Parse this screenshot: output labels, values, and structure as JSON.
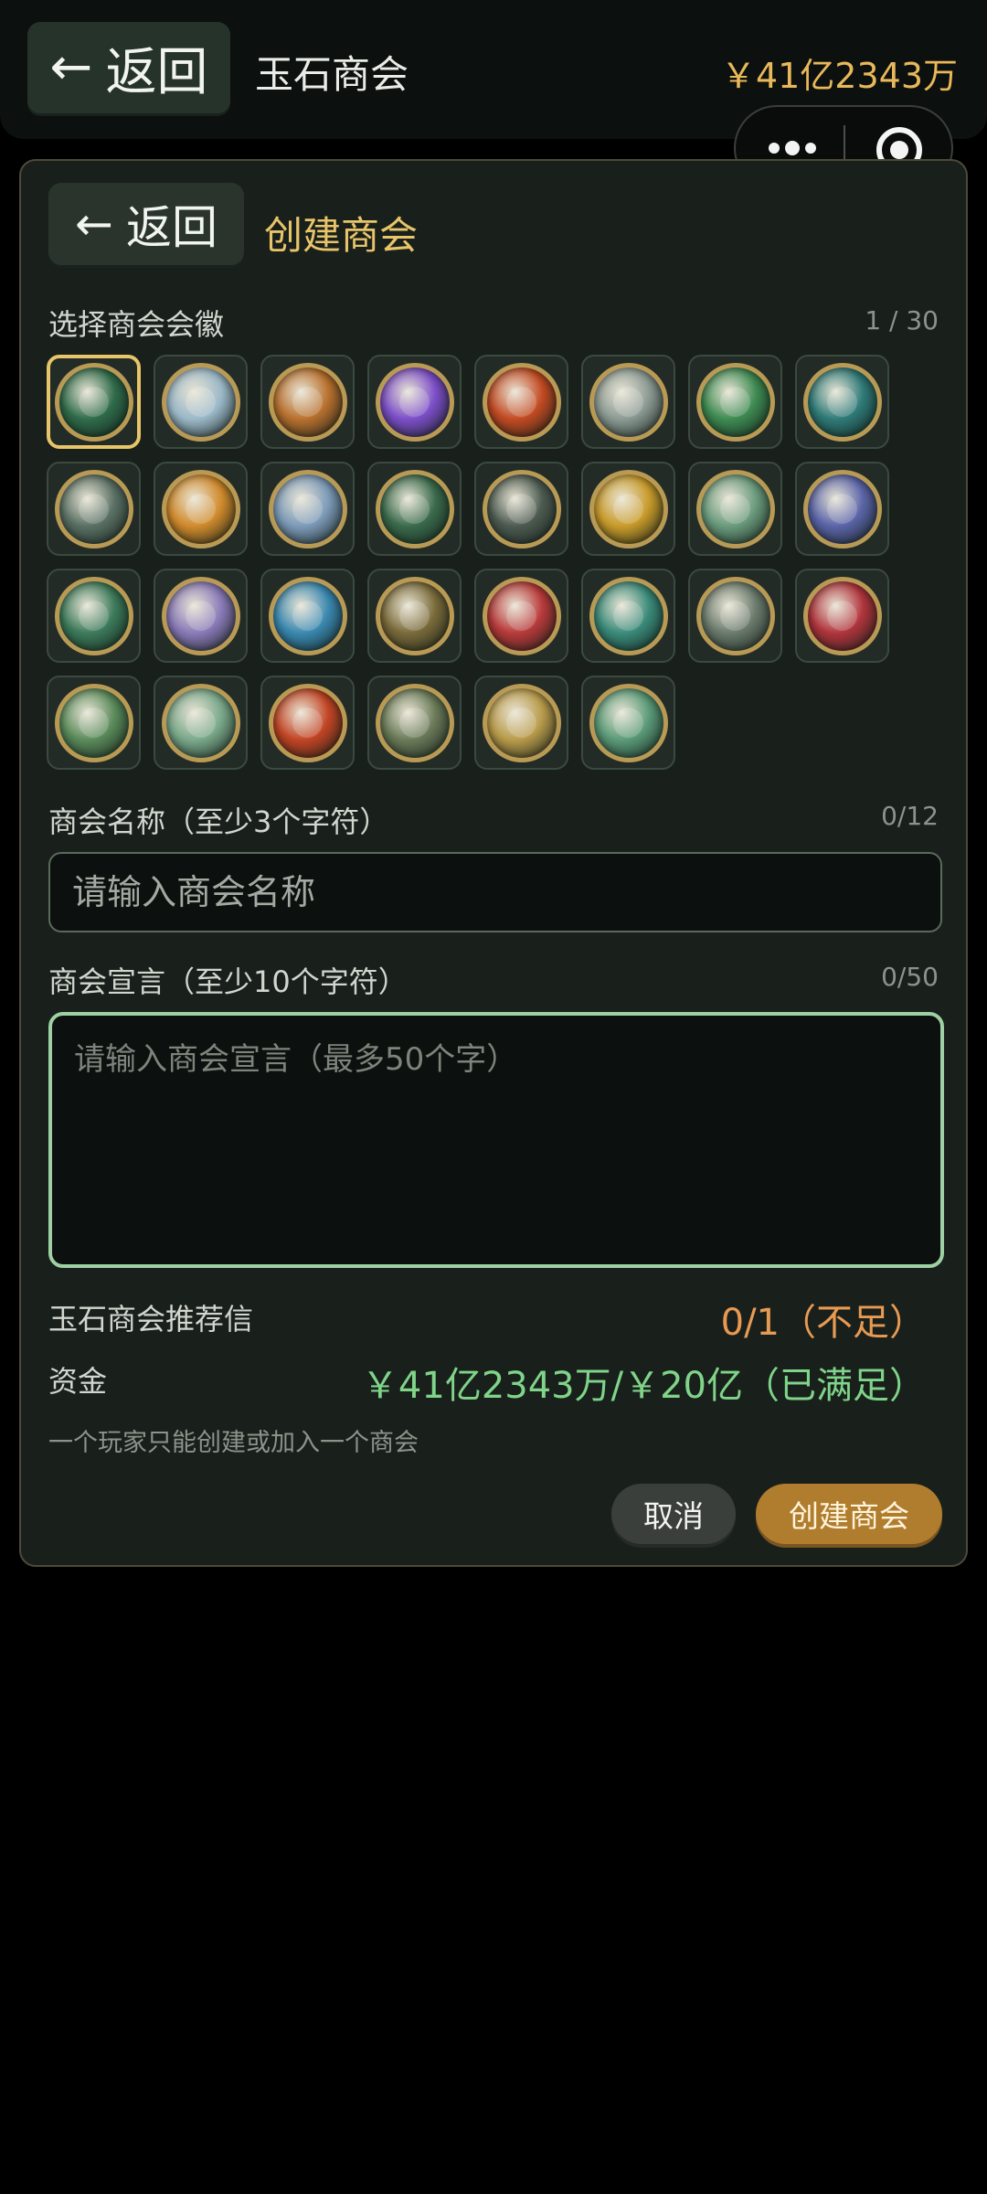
{
  "topbar": {
    "back_label": "返回",
    "title": "玉石商会",
    "money": "￥41亿2343万"
  },
  "panel": {
    "back_label": "返回",
    "title": "创建商会",
    "emblem_section_label": "选择商会会徽",
    "emblem_counter": "1 / 30",
    "emblems": [
      {
        "name": "jade-coin-dragon",
        "color": "#2f6b4a",
        "selected": true
      },
      {
        "name": "white-crane",
        "color": "#9bb8c8"
      },
      {
        "name": "tiger-shield",
        "color": "#b8702e"
      },
      {
        "name": "purple-lotus-orb",
        "color": "#7c4ec8"
      },
      {
        "name": "phoenix-shield",
        "color": "#c24a22"
      },
      {
        "name": "mountain-crest",
        "color": "#8c9a94"
      },
      {
        "name": "jade-drop-ring",
        "color": "#3e8a52"
      },
      {
        "name": "teal-dragon",
        "color": "#2e7a78"
      },
      {
        "name": "crossed-swords",
        "color": "#5a7064"
      },
      {
        "name": "golden-lantern",
        "color": "#d08a2c"
      },
      {
        "name": "silver-wolf",
        "color": "#7c9ab8"
      },
      {
        "name": "jade-helmet",
        "color": "#3a6a4c"
      },
      {
        "name": "winged-crest",
        "color": "#4c5a50"
      },
      {
        "name": "golden-lion",
        "color": "#c89a2a"
      },
      {
        "name": "blossom-fan",
        "color": "#6a9a7c"
      },
      {
        "name": "compass-star",
        "color": "#5a64a8"
      },
      {
        "name": "crystal-hammer",
        "color": "#3c7a5a"
      },
      {
        "name": "lavender-vase",
        "color": "#8a7ab8"
      },
      {
        "name": "azure-wave-pearl",
        "color": "#3a88b0"
      },
      {
        "name": "bull-skull",
        "color": "#7a6a3a"
      },
      {
        "name": "red-fox-mask",
        "color": "#b83a3a"
      },
      {
        "name": "peacock-fan",
        "color": "#3a8a7a"
      },
      {
        "name": "ancient-coin",
        "color": "#6a7a6c"
      },
      {
        "name": "red-diamond-blade",
        "color": "#b0343c"
      },
      {
        "name": "jade-crossed-picks",
        "color": "#5a8a5a"
      },
      {
        "name": "jade-butterfly",
        "color": "#7aa88a"
      },
      {
        "name": "crimson-flame-shield",
        "color": "#c24424"
      },
      {
        "name": "bronze-bell",
        "color": "#6a7a58"
      },
      {
        "name": "golden-ship",
        "color": "#b89a4a"
      },
      {
        "name": "jade-stag",
        "color": "#5a9a78"
      }
    ],
    "name_label": "商会名称（至少3个字符）",
    "name_counter": "0/12",
    "name_placeholder": "请输入商会名称",
    "manifesto_label": "商会宣言（至少10个字符）",
    "manifesto_counter": "0/50",
    "manifesto_placeholder": "请输入商会宣言（最多50个字）",
    "requirements": {
      "letter_label": "玉石商会推荐信",
      "letter_value": "0/1（不足）",
      "funds_label": "资金",
      "funds_value": "￥41亿2343万/￥20亿（已满足）"
    },
    "note": "一个玩家只能创建或加入一个商会",
    "cancel_label": "取消",
    "create_label": "创建商会"
  }
}
